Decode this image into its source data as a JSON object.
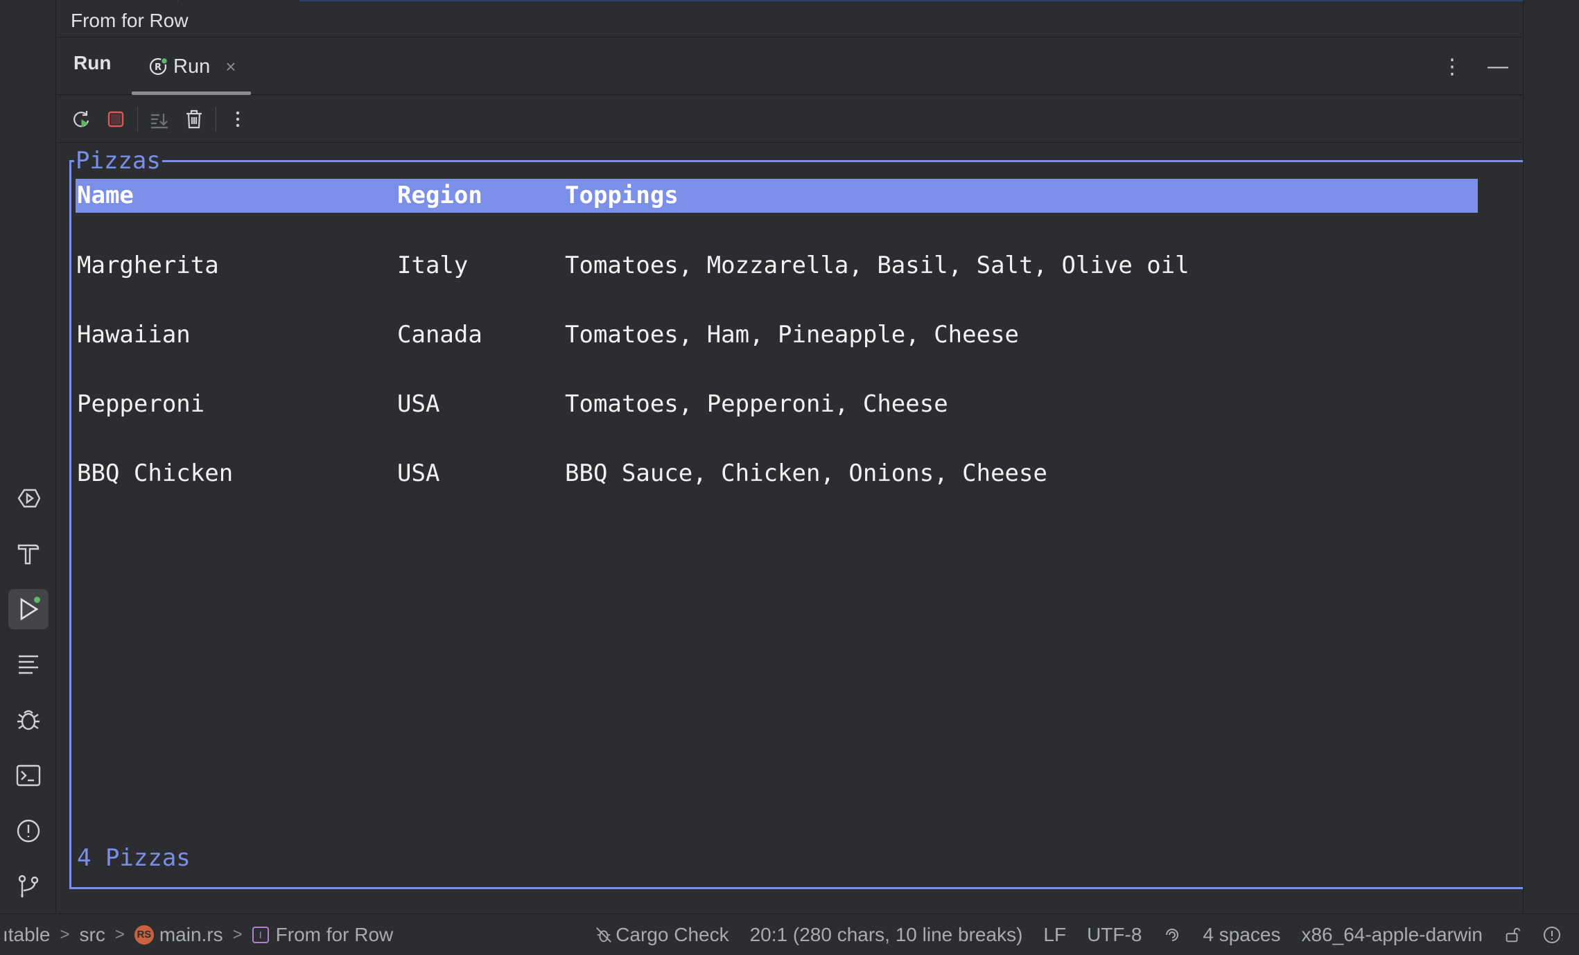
{
  "breadcrumb_title": "From for Row",
  "tool_window": {
    "title": "Run",
    "tab_label": "Run",
    "tab_close": "×",
    "more_icon": "⋮",
    "minimize_icon": "—"
  },
  "terminal": {
    "table_title": "Pizzas",
    "headers": {
      "name": "Name",
      "region": "Region",
      "toppings": "Toppings"
    },
    "rows": [
      {
        "name": "Margherita",
        "region": "Italy",
        "toppings": "Tomatoes, Mozzarella, Basil, Salt, Olive oil"
      },
      {
        "name": "Hawaiian",
        "region": "Canada",
        "toppings": "Tomatoes, Ham, Pineapple, Cheese"
      },
      {
        "name": "Pepperoni",
        "region": "USA",
        "toppings": "Tomatoes, Pepperoni, Cheese"
      },
      {
        "name": "BBQ Chicken",
        "region": "USA",
        "toppings": "BBQ Sauce, Chicken, Onions, Cheese"
      }
    ],
    "footer": "4 Pizzas"
  },
  "status_bar": {
    "crumbs": [
      "ıtable",
      "src",
      "main.rs",
      "From for Row"
    ],
    "rust_badge": "RS",
    "trait_badge": "I",
    "cargo_check": "Cargo Check",
    "position": "20:1 (280 chars, 10 line breaks)",
    "line_sep": "LF",
    "encoding": "UTF-8",
    "indent": "4 spaces",
    "target": "x86_64-apple-darwin"
  },
  "colors": {
    "accent": "#7b8fe8",
    "background": "#2b2d30",
    "stop": "#e05555",
    "green": "#5fb865"
  }
}
